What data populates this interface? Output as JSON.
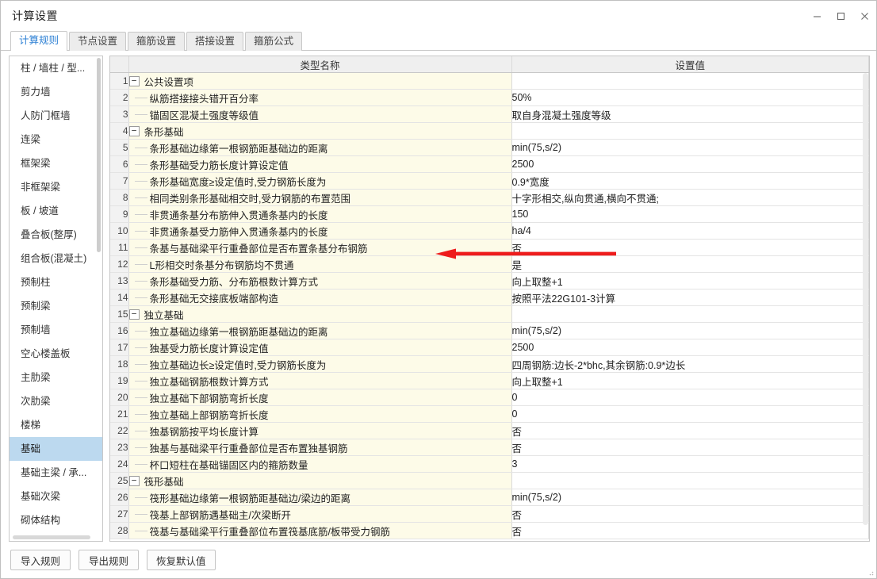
{
  "window": {
    "title": "计算设置",
    "controls": [
      {
        "name": "minimize",
        "glyph": "—"
      },
      {
        "name": "maximize",
        "glyph": "☐"
      },
      {
        "name": "close",
        "glyph": "✕"
      }
    ]
  },
  "tabs": [
    {
      "label": "计算规则",
      "active": true
    },
    {
      "label": "节点设置",
      "active": false
    },
    {
      "label": "箍筋设置",
      "active": false
    },
    {
      "label": "搭接设置",
      "active": false
    },
    {
      "label": "箍筋公式",
      "active": false
    }
  ],
  "sidebar": {
    "selected": "基础",
    "items": [
      {
        "label": "柱 / 墙柱 / 型..."
      },
      {
        "label": "剪力墙"
      },
      {
        "label": "人防门框墙"
      },
      {
        "label": "连梁"
      },
      {
        "label": "框架梁"
      },
      {
        "label": "非框架梁"
      },
      {
        "label": "板 / 坡道"
      },
      {
        "label": "叠合板(整厚)"
      },
      {
        "label": "组合板(混凝土)"
      },
      {
        "label": "预制柱"
      },
      {
        "label": "预制梁"
      },
      {
        "label": "预制墙"
      },
      {
        "label": "空心楼盖板"
      },
      {
        "label": "主肋梁"
      },
      {
        "label": "次肋梁"
      },
      {
        "label": "楼梯"
      },
      {
        "label": "基础"
      },
      {
        "label": "基础主梁 / 承..."
      },
      {
        "label": "基础次梁"
      },
      {
        "label": "砌体结构"
      }
    ]
  },
  "grid": {
    "columns": [
      {
        "key": "num",
        "label": ""
      },
      {
        "key": "name",
        "label": "类型名称"
      },
      {
        "key": "value",
        "label": "设置值"
      }
    ],
    "rows": [
      {
        "num": "1",
        "type": "group",
        "name": "公共设置项",
        "value": ""
      },
      {
        "num": "2",
        "type": "item",
        "name": "纵筋搭接接头错开百分率",
        "value": "50%"
      },
      {
        "num": "3",
        "type": "item",
        "name": "锚固区混凝土强度等级值",
        "value": "取自身混凝土强度等级"
      },
      {
        "num": "4",
        "type": "group",
        "name": "条形基础",
        "value": ""
      },
      {
        "num": "5",
        "type": "item",
        "name": "条形基础边缘第一根钢筋距基础边的距离",
        "value": "min(75,s/2)"
      },
      {
        "num": "6",
        "type": "item",
        "name": "条形基础受力筋长度计算设定值",
        "value": "2500"
      },
      {
        "num": "7",
        "type": "item",
        "name": "条形基础宽度≥设定值时,受力钢筋长度为",
        "value": "0.9*宽度"
      },
      {
        "num": "8",
        "type": "item",
        "name": "相同类别条形基础相交时,受力钢筋的布置范围",
        "value": "十字形相交,纵向贯通,横向不贯通;"
      },
      {
        "num": "9",
        "type": "item",
        "name": "非贯通条基分布筋伸入贯通条基内的长度",
        "value": "150"
      },
      {
        "num": "10",
        "type": "item",
        "name": "非贯通条基受力筋伸入贯通条基内的长度",
        "value": "ha/4"
      },
      {
        "num": "11",
        "type": "item",
        "name": "条基与基础梁平行重叠部位是否布置条基分布钢筋",
        "value": "否",
        "annotated": true
      },
      {
        "num": "12",
        "type": "item",
        "name": "L形相交时条基分布钢筋均不贯通",
        "value": "是"
      },
      {
        "num": "13",
        "type": "item",
        "name": "条形基础受力筋、分布筋根数计算方式",
        "value": "向上取整+1"
      },
      {
        "num": "14",
        "type": "item",
        "name": "条形基础无交接底板端部构造",
        "value": "按照平法22G101-3计算"
      },
      {
        "num": "15",
        "type": "group",
        "name": "独立基础",
        "value": ""
      },
      {
        "num": "16",
        "type": "item",
        "name": "独立基础边缘第一根钢筋距基础边的距离",
        "value": "min(75,s/2)"
      },
      {
        "num": "17",
        "type": "item",
        "name": "独基受力筋长度计算设定值",
        "value": "2500"
      },
      {
        "num": "18",
        "type": "item",
        "name": "独立基础边长≥设定值时,受力钢筋长度为",
        "value": "四周钢筋:边长-2*bhc,其余钢筋:0.9*边长"
      },
      {
        "num": "19",
        "type": "item",
        "name": "独立基础钢筋根数计算方式",
        "value": "向上取整+1"
      },
      {
        "num": "20",
        "type": "item",
        "name": "独立基础下部钢筋弯折长度",
        "value": "0"
      },
      {
        "num": "21",
        "type": "item",
        "name": "独立基础上部钢筋弯折长度",
        "value": "0"
      },
      {
        "num": "22",
        "type": "item",
        "name": "独基钢筋按平均长度计算",
        "value": "否"
      },
      {
        "num": "23",
        "type": "item",
        "name": "独基与基础梁平行重叠部位是否布置独基钢筋",
        "value": "否"
      },
      {
        "num": "24",
        "type": "item",
        "name": "杯口短柱在基础锚固区内的箍筋数量",
        "value": "3"
      },
      {
        "num": "25",
        "type": "group",
        "name": "筏形基础",
        "value": ""
      },
      {
        "num": "26",
        "type": "item",
        "name": "筏形基础边缘第一根钢筋距基础边/梁边的距离",
        "value": "min(75,s/2)"
      },
      {
        "num": "27",
        "type": "item",
        "name": "筏基上部钢筋遇基础主/次梁断开",
        "value": "否"
      },
      {
        "num": "28",
        "type": "item",
        "name": "筏基与基础梁平行重叠部位布置筏基底筋/板带受力钢筋",
        "value": "否"
      }
    ],
    "expander_collapse_glyph": "−"
  },
  "annotation": {
    "color": "#ee1c1c",
    "target_row": "11"
  },
  "footer": {
    "buttons": [
      {
        "label": "导入规则",
        "name": "import-rules-button"
      },
      {
        "label": "导出规则",
        "name": "export-rules-button"
      },
      {
        "label": "恢复默认值",
        "name": "restore-defaults-button"
      }
    ]
  }
}
